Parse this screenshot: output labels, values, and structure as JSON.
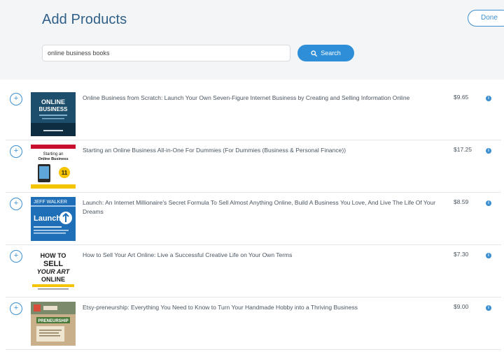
{
  "header": {
    "title": "Add Products",
    "done_label": "Done"
  },
  "search": {
    "value": "online business books",
    "button_label": "Search"
  },
  "colors": {
    "accent": "#2e8fd8",
    "title": "#2f5f87",
    "header_bg": "#f4f5f7"
  },
  "products": [
    {
      "title": "Online Business from Scratch: Launch Your Own Seven-Figure Internet Business by Creating and Selling Information Online",
      "price": "$9.65"
    },
    {
      "title": "Starting an Online Business All-in-One For Dummies (For Dummies (Business & Personal Finance))",
      "price": "$17.25"
    },
    {
      "title": "Launch: An Internet Millionaire's Secret Formula To Sell Almost Anything Online, Build A Business You Love, And Live The Life Of Your Dreams",
      "price": "$8.59"
    },
    {
      "title": "How to Sell Your Art Online: Live a Successful Creative Life on Your Own Terms",
      "price": "$7.30"
    },
    {
      "title": "Etsy-preneurship: Everything You Need to Know to Turn Your Handmade Hobby into a Thriving Business",
      "price": "$9.00"
    }
  ],
  "covers": {
    "cover1": {
      "line1": "ONLINE",
      "line2": "BUSINESS"
    },
    "cover2": {
      "line1": "Starting an",
      "line2": "Online Business"
    },
    "cover3": {
      "line1": "JEFF WALKER",
      "line2": "Launch"
    },
    "cover4": {
      "line1": "HOW TO",
      "line2": "SELL",
      "line3": "YOUR ART",
      "line4": "ONLINE"
    },
    "cover5": {
      "line1": "PRENEURSHIP"
    }
  }
}
